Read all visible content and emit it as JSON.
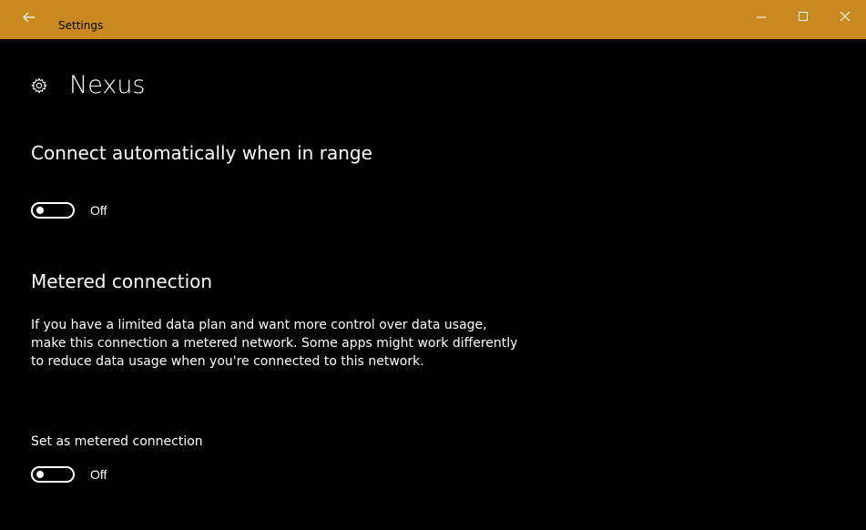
{
  "window": {
    "title": "Settings",
    "accent_color": "#ca8a21",
    "background_color": "#000000",
    "icons": {
      "back": "back-arrow-icon",
      "minimize": "minimize-icon",
      "maximize": "maximize-icon",
      "close": "close-icon"
    }
  },
  "page": {
    "title": "Nexus",
    "icon": "gear-icon"
  },
  "auto_connect": {
    "heading": "Connect automatically when in range",
    "toggle_state": "Off"
  },
  "metered": {
    "heading": "Metered connection",
    "description": "If you have a limited data plan and want more control over data usage, make this connection a metered network. Some apps might work differently to reduce data usage when you're connected to this network.",
    "setting_label": "Set as metered connection",
    "toggle_state": "Off"
  }
}
